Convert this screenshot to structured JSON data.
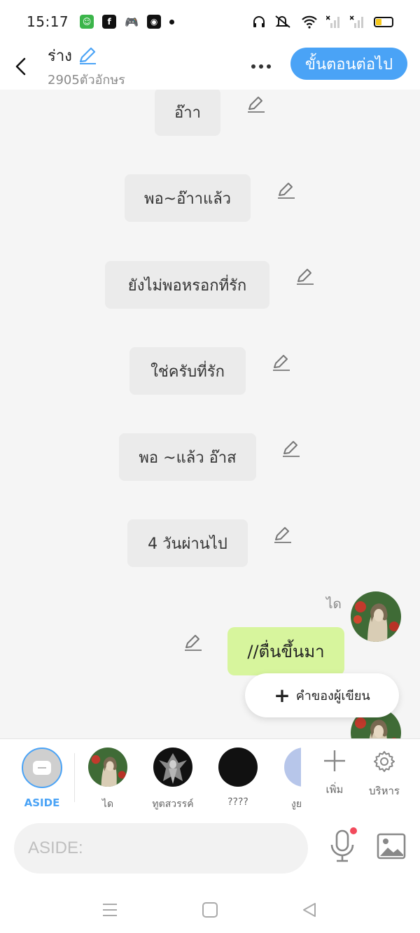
{
  "status_bar": {
    "time": "15:17",
    "left_icons": [
      "app-green-icon",
      "facebook-icon",
      "game-icon",
      "camera-app-icon",
      "notification-dot-icon"
    ],
    "right_icons": [
      "headphones-icon",
      "mute-icon",
      "wifi-icon",
      "signal-x-icon",
      "signal-x-icon",
      "battery-icon"
    ],
    "battery_level": 0.35,
    "battery_color": "#f6c81a"
  },
  "header": {
    "title": "ร่าง",
    "char_count": "2905ตัวอักษร",
    "next_label": "ขั้นตอนต่อไป",
    "accent_color": "#4aa3f6"
  },
  "narration": [
    {
      "text": "อ๊าา"
    },
    {
      "text": "พอ~อ๊าาแล้ว"
    },
    {
      "text": "ยังไม่พอหรอกที่รัก"
    },
    {
      "text": "ใช่ครับที่รัก"
    },
    {
      "text": "พอ ~แล้ว อ๊าส"
    },
    {
      "text": "4 วันผ่านไป"
    }
  ],
  "message": {
    "speaker": "ได",
    "text": "//ตื่นขึ้นมา",
    "bubble_color": "#d7f59d"
  },
  "aside_popup": {
    "label": "คำของผู้เขียน"
  },
  "characters": [
    {
      "name": "ASIDE"
    },
    {
      "name": "ได"
    },
    {
      "name": "ทูตสวรรค์"
    },
    {
      "name": "????"
    },
    {
      "name": "งูย"
    }
  ],
  "tools": {
    "add_label": "เพิ่ม",
    "manage_label": "บริหาร"
  },
  "input": {
    "placeholder": "ASIDE:"
  }
}
